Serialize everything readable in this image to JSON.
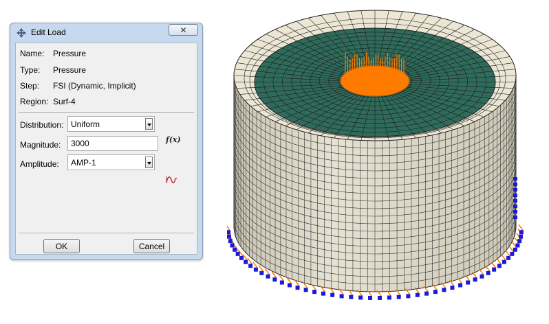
{
  "dialog": {
    "title": "Edit Load",
    "close_label": "✕",
    "info": [
      {
        "label": "Name:",
        "value": "Pressure"
      },
      {
        "label": "Type:",
        "value": "Pressure"
      },
      {
        "label": "Step:",
        "value": "FSI (Dynamic, Implicit)"
      },
      {
        "label": "Region:",
        "value": "Surf-4"
      }
    ],
    "distribution": {
      "label": "Distribution:",
      "value": "Uniform"
    },
    "magnitude": {
      "label": "Magnitude:",
      "value": "3000"
    },
    "amplitude": {
      "label": "Amplitude:",
      "value": "AMP-1"
    },
    "fx_label": "f(x)",
    "ok_label": "OK",
    "cancel_label": "Cancel"
  },
  "icons": {
    "title": "edit-load-icon",
    "region": "region-select-arrow-icon",
    "fx": "function-icon",
    "amplitude": "amplitude-curve-icon"
  },
  "colors": {
    "dialog_frame": "#c7d9ee",
    "mesh_top": "#2e6a58",
    "mesh_side": "#ddd8c6",
    "load": "#ff7b00",
    "boundary": "#1a1ad9"
  }
}
